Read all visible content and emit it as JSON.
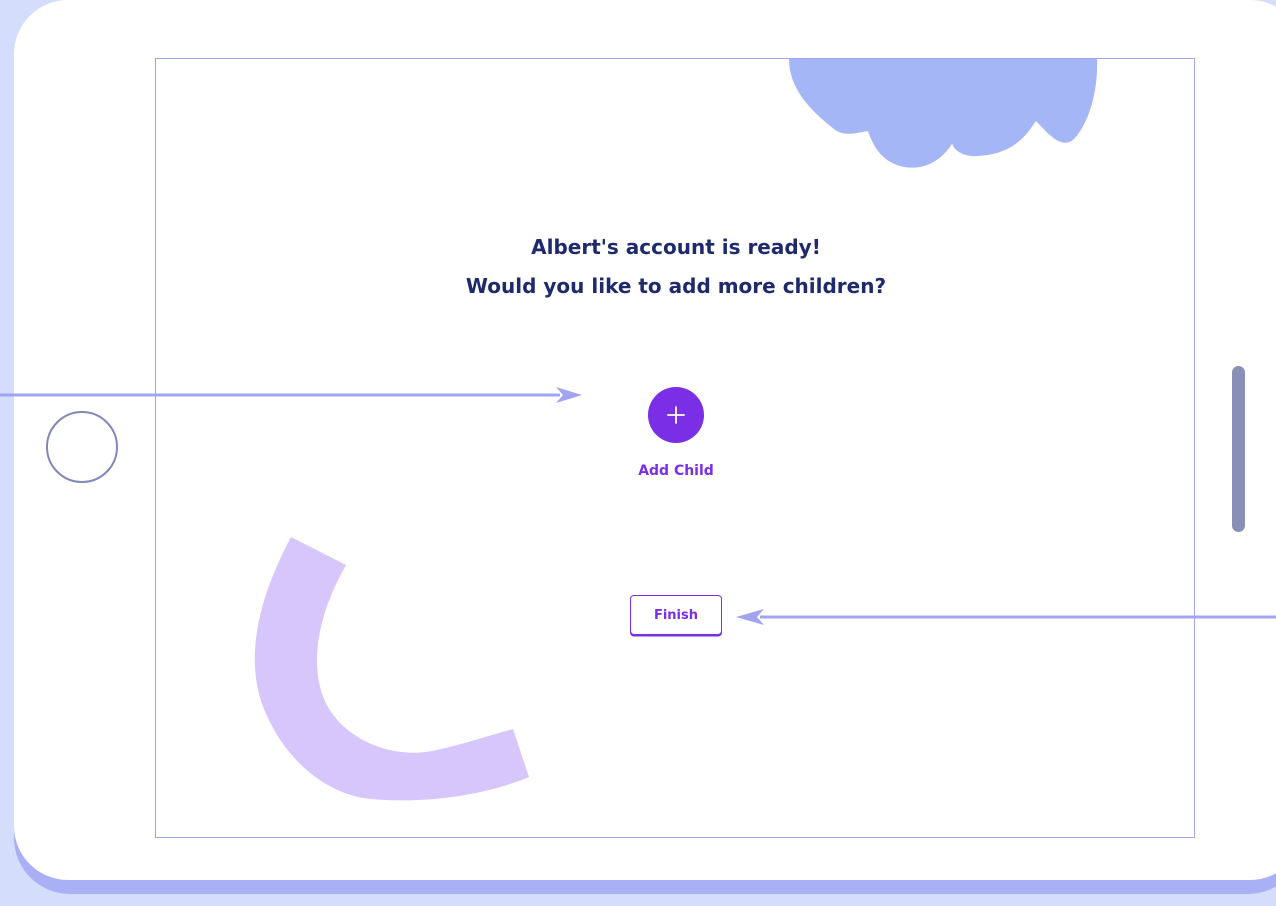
{
  "heading": {
    "line1": "Albert's account is ready!",
    "line2": "Would you like to add more children?"
  },
  "add_child": {
    "icon": "plus-icon",
    "label": "Add Child"
  },
  "finish": {
    "label": "Finish"
  },
  "colors": {
    "background": "#d4ddfb",
    "tablet_shadow": "#a9b0f5",
    "screen_border": "#a0a4f2",
    "heading_text": "#1e2a6b",
    "accent_purple": "#7a2ee6",
    "cloud": "#a4b6f5",
    "arc": "#d6c6fb",
    "arrow": "#a0a4f2",
    "device_controls": "#8a90b5"
  }
}
